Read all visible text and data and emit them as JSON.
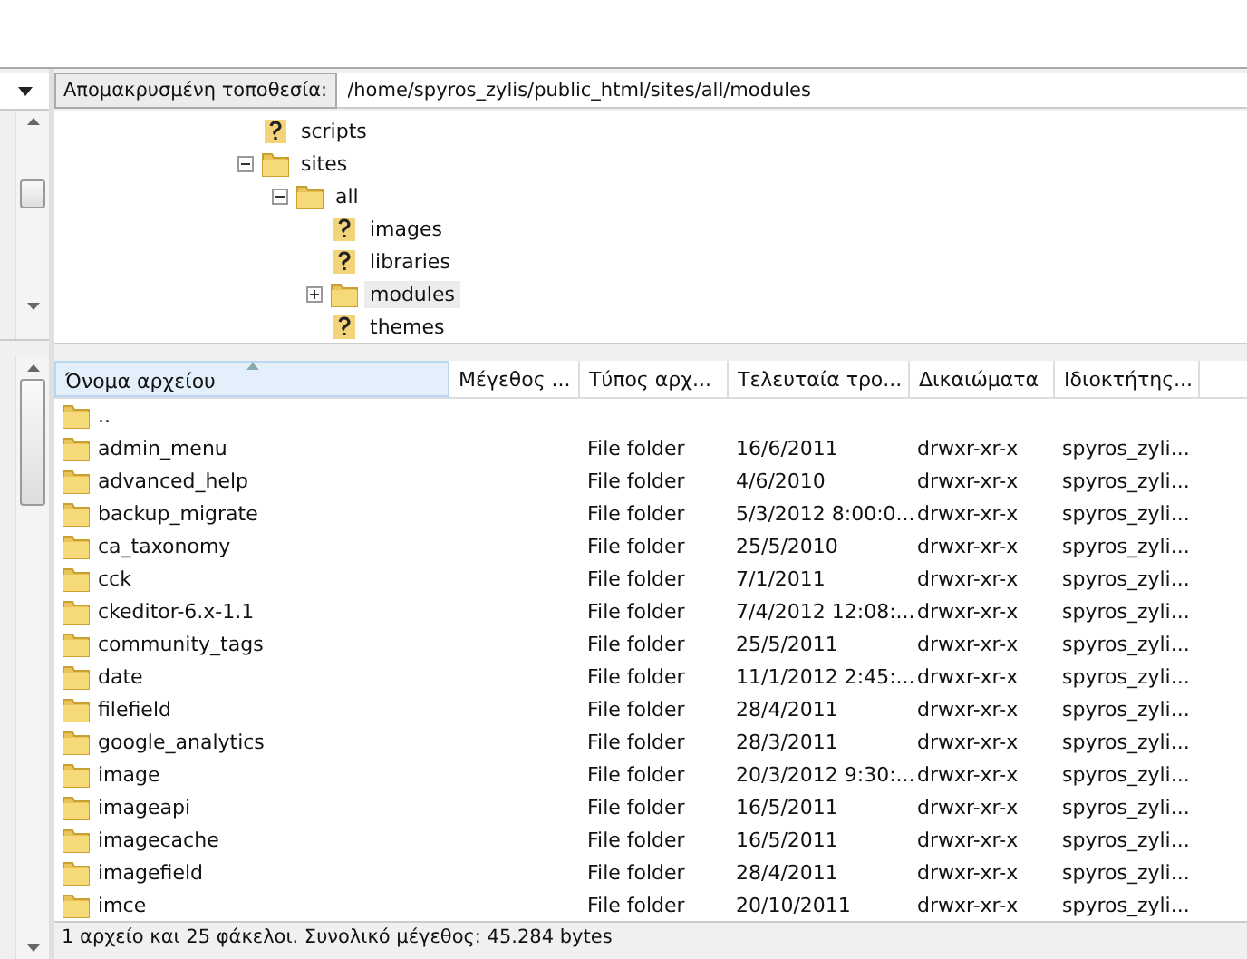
{
  "address_bar": {
    "label": "Απομακρυσμένη τοποθεσία:",
    "value": "/home/spyros_zylis/public_html/sites/all/modules"
  },
  "tree": [
    {
      "label": "scripts",
      "kind": "unknown",
      "selected": false
    },
    {
      "label": "sites",
      "kind": "folder",
      "expanded": true,
      "selected": false,
      "children": [
        {
          "label": "all",
          "kind": "folder",
          "expanded": true,
          "selected": false,
          "children": [
            {
              "label": "images",
              "kind": "unknown",
              "selected": false
            },
            {
              "label": "libraries",
              "kind": "unknown",
              "selected": false
            },
            {
              "label": "modules",
              "kind": "folder",
              "expanded": false,
              "selected": true
            },
            {
              "label": "themes",
              "kind": "unknown",
              "selected": false
            }
          ]
        }
      ]
    }
  ],
  "table": {
    "columns": [
      {
        "label": "Όνομα αρχείου",
        "sorted": true
      },
      {
        "label": "Μέγεθος ...",
        "sorted": false
      },
      {
        "label": "Τύπος αρχ...",
        "sorted": false
      },
      {
        "label": "Τελευταία τρο...",
        "sorted": false
      },
      {
        "label": "Δικαιώματα",
        "sorted": false
      },
      {
        "label": "Ιδιοκτήτης...",
        "sorted": false
      }
    ],
    "rows": [
      {
        "name": "..",
        "type": "",
        "modified": "",
        "permissions": "",
        "owner": ""
      },
      {
        "name": "admin_menu",
        "type": "File folder",
        "modified": "16/6/2011",
        "permissions": "drwxr-xr-x",
        "owner": "spyros_zyli..."
      },
      {
        "name": "advanced_help",
        "type": "File folder",
        "modified": "4/6/2010",
        "permissions": "drwxr-xr-x",
        "owner": "spyros_zyli..."
      },
      {
        "name": "backup_migrate",
        "type": "File folder",
        "modified": "5/3/2012 8:00:0...",
        "permissions": "drwxr-xr-x",
        "owner": "spyros_zyli..."
      },
      {
        "name": "ca_taxonomy",
        "type": "File folder",
        "modified": "25/5/2010",
        "permissions": "drwxr-xr-x",
        "owner": "spyros_zyli..."
      },
      {
        "name": "cck",
        "type": "File folder",
        "modified": "7/1/2011",
        "permissions": "drwxr-xr-x",
        "owner": "spyros_zyli..."
      },
      {
        "name": "ckeditor-6.x-1.1",
        "type": "File folder",
        "modified": "7/4/2012 12:08:...",
        "permissions": "drwxr-xr-x",
        "owner": "spyros_zyli..."
      },
      {
        "name": "community_tags",
        "type": "File folder",
        "modified": "25/5/2011",
        "permissions": "drwxr-xr-x",
        "owner": "spyros_zyli..."
      },
      {
        "name": "date",
        "type": "File folder",
        "modified": "11/1/2012 2:45:...",
        "permissions": "drwxr-xr-x",
        "owner": "spyros_zyli..."
      },
      {
        "name": "filefield",
        "type": "File folder",
        "modified": "28/4/2011",
        "permissions": "drwxr-xr-x",
        "owner": "spyros_zyli..."
      },
      {
        "name": "google_analytics",
        "type": "File folder",
        "modified": "28/3/2011",
        "permissions": "drwxr-xr-x",
        "owner": "spyros_zyli..."
      },
      {
        "name": "image",
        "type": "File folder",
        "modified": "20/3/2012 9:30:...",
        "permissions": "drwxr-xr-x",
        "owner": "spyros_zyli..."
      },
      {
        "name": "imageapi",
        "type": "File folder",
        "modified": "16/5/2011",
        "permissions": "drwxr-xr-x",
        "owner": "spyros_zyli..."
      },
      {
        "name": "imagecache",
        "type": "File folder",
        "modified": "16/5/2011",
        "permissions": "drwxr-xr-x",
        "owner": "spyros_zyli..."
      },
      {
        "name": "imagefield",
        "type": "File folder",
        "modified": "28/4/2011",
        "permissions": "drwxr-xr-x",
        "owner": "spyros_zyli..."
      },
      {
        "name": "imce",
        "type": "File folder",
        "modified": "20/10/2011",
        "permissions": "drwxr-xr-x",
        "owner": "spyros_zyli..."
      }
    ]
  },
  "status_bar": "1 αρχείο και 25 φάκελοι. Συνολικό μέγεθος: 45.284 bytes"
}
